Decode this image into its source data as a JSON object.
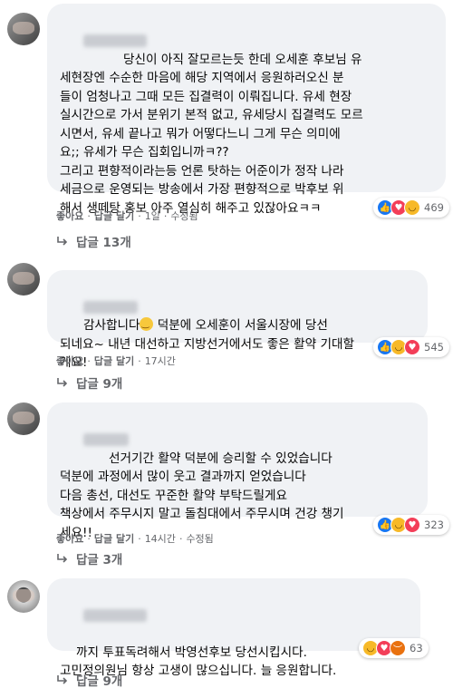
{
  "actions": {
    "like": "좋아요",
    "reply": "답글 달기"
  },
  "comments": [
    {
      "text": "당신이 아직 잘모르는듯 한데 오세훈 후보님 유\n세현장엔 수순한 마음에 해당 지역에서 응원하러오신 분\n들이 엄청나고 그때 모든 집결력이 이뤄집니다. 유세 현장\n실시간으로 가서 분위기 본적 없고, 유세당시 집결력도 모르\n시면서, 유세 끝나고 뭐가 어떻다느니 그게 무슨 의미에\n요;; 유세가 무슨 집회입니까ㅋ??\n그리고 편향적이라는등 언론 탓하는 어준이가 정작 나라\n세금으로 운영되는 방송에서 가장 편향적으로 박후보 위\n해서 생떼탕 홍보 아주 열심히 해주고 있잖아요ㅋㅋ",
      "time": "1일",
      "edited": "수정됨",
      "reaction_count": "469",
      "reactions": [
        "like-icon",
        "love-icon",
        "haha-icon"
      ],
      "replies": "답글 13개"
    },
    {
      "text_before_emoji": "감사합니다",
      "text_after_emoji": " 덕분에 오세훈이 서울시장에 당선\n되네요~ 내년 대선하고 지방선거에서도 좋은 활약 기대할\n게요!",
      "time": "17시간",
      "reaction_count": "545",
      "reactions": [
        "like-icon",
        "haha-icon",
        "love-icon"
      ],
      "replies": "답글 9개"
    },
    {
      "text": "선거기간 활약 덕분에 승리할 수 있었습니다\n덕분에 과정에서 많이 웃고 결과까지 얻었습니다\n다음 총선, 대선도 꾸준한 활약 부탁드릴게요\n책상에서 주무시지 말고 돌침대에서 주무시며 건강 챙기\n세요!!",
      "time": "14시간",
      "edited": "수정됨",
      "reaction_count": "323",
      "reactions": [
        "like-icon",
        "haha-icon",
        "love-icon"
      ],
      "replies": "답글 3개"
    },
    {
      "text": "까지 투표독려해서 박영선후보 당선시킵시다.\n고민정의원님 항상 고생이 많으십니다. 늘 응원합니다.",
      "time": "",
      "reaction_count": "63",
      "reactions": [
        "haha-icon",
        "love-icon",
        "angry-icon"
      ],
      "replies": "답글 9개"
    }
  ]
}
